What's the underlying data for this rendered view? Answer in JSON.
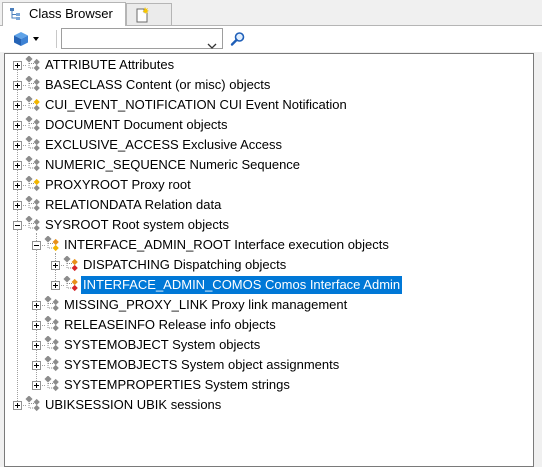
{
  "tabs": [
    {
      "label": "Class Browser",
      "active": true,
      "icon": "class-tree-icon"
    },
    {
      "label": "",
      "active": false,
      "icon": "new-document-icon"
    }
  ],
  "toolbar": {
    "class_button_icon": "cube-icon",
    "search_combo_value": "",
    "search_button_icon": "search-icon"
  },
  "colors": {
    "selection": "#0078d7",
    "icon_gray": "#8c8c8c",
    "icon_yellow": "#f2b600",
    "icon_orange": "#e8901a",
    "icon_red": "#d7262b"
  },
  "tree": {
    "nodes": [
      {
        "label": "ATTRIBUTE Attributes",
        "depth": 0,
        "expander": "plus",
        "icon": "class-gray-icon"
      },
      {
        "label": "BASECLASS Content (or misc) objects",
        "depth": 0,
        "expander": "plus",
        "icon": "class-gray-icon"
      },
      {
        "label": "CUI_EVENT_NOTIFICATION CUI Event Notification",
        "depth": 0,
        "expander": "plus",
        "icon": "class-yellow-icon"
      },
      {
        "label": "DOCUMENT Document objects",
        "depth": 0,
        "expander": "plus",
        "icon": "class-gray-icon"
      },
      {
        "label": "EXCLUSIVE_ACCESS Exclusive Access",
        "depth": 0,
        "expander": "plus",
        "icon": "class-gray-icon"
      },
      {
        "label": "NUMERIC_SEQUENCE Numeric Sequence",
        "depth": 0,
        "expander": "plus",
        "icon": "class-gray-icon"
      },
      {
        "label": "PROXYROOT Proxy root",
        "depth": 0,
        "expander": "plus",
        "icon": "class-yellow-icon"
      },
      {
        "label": "RELATIONDATA Relation data",
        "depth": 0,
        "expander": "plus",
        "icon": "class-gray-icon"
      },
      {
        "label": "SYSROOT Root system objects",
        "depth": 0,
        "expander": "minus",
        "icon": "class-gray-icon"
      },
      {
        "label": "INTERFACE_ADMIN_ROOT Interface execution objects",
        "depth": 1,
        "expander": "minus",
        "icon": "class-orange-icon"
      },
      {
        "label": "DISPATCHING Dispatching objects",
        "depth": 2,
        "expander": "plus",
        "icon": "class-multi-icon"
      },
      {
        "label": "INTERFACE_ADMIN_COMOS Comos Interface Admin",
        "depth": 2,
        "expander": "plus",
        "icon": "class-multi-icon",
        "selected": true
      },
      {
        "label": "MISSING_PROXY_LINK Proxy link management",
        "depth": 1,
        "expander": "plus",
        "icon": "class-gray-icon"
      },
      {
        "label": "RELEASEINFO Release info objects",
        "depth": 1,
        "expander": "plus",
        "icon": "class-gray-icon"
      },
      {
        "label": "SYSTEMOBJECT System objects",
        "depth": 1,
        "expander": "plus",
        "icon": "class-gray-icon"
      },
      {
        "label": "SYSTEMOBJECTS System object assignments",
        "depth": 1,
        "expander": "plus",
        "icon": "class-gray-icon"
      },
      {
        "label": "SYSTEMPROPERTIES System strings",
        "depth": 1,
        "expander": "plus",
        "icon": "class-gray-icon"
      },
      {
        "label": "UBIKSESSION UBIK sessions",
        "depth": 0,
        "expander": "plus",
        "icon": "class-gray-icon"
      }
    ]
  }
}
